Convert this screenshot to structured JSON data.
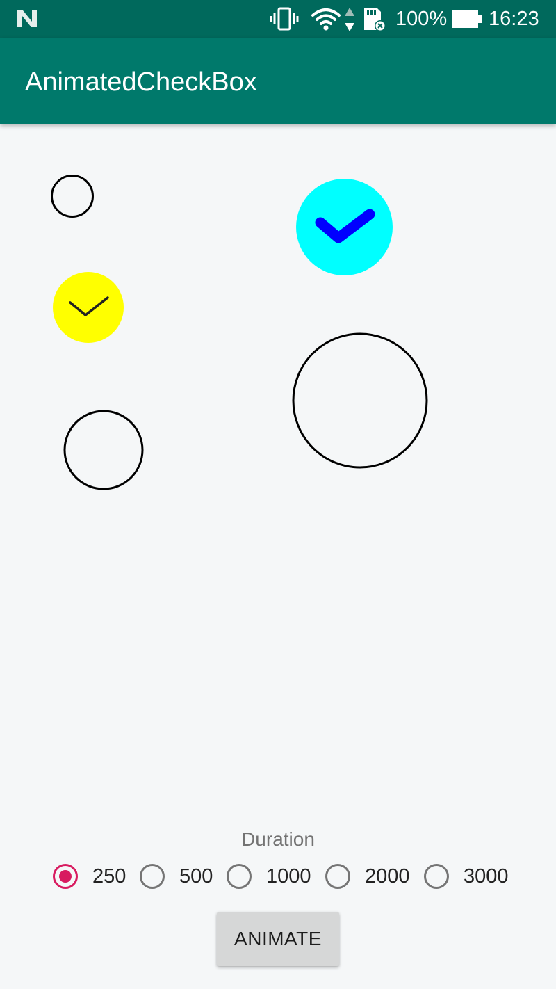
{
  "status_bar": {
    "battery_percent": "100%",
    "time": "16:23",
    "icons": [
      "n-logo-icon",
      "vibrate-icon",
      "wifi-icon",
      "data-arrows-icon",
      "sd-card-icon",
      "battery-icon"
    ]
  },
  "app_bar": {
    "title": "AnimatedCheckBox"
  },
  "checkboxes": [
    {
      "id": "small-unchecked",
      "checked": false,
      "fill_color": null,
      "stroke_color": "#000000"
    },
    {
      "id": "cyan-checked",
      "checked": true,
      "fill_color": "#00ffff",
      "check_color": "#0000ff"
    },
    {
      "id": "yellow-checked",
      "checked": true,
      "fill_color": "#ffff00",
      "check_color": "#222222"
    },
    {
      "id": "large-unchecked",
      "checked": false,
      "fill_color": null,
      "stroke_color": "#000000"
    },
    {
      "id": "medium-unchecked",
      "checked": false,
      "fill_color": null,
      "stroke_color": "#000000"
    }
  ],
  "duration": {
    "label": "Duration",
    "options": [
      "250",
      "500",
      "1000",
      "2000",
      "3000"
    ],
    "selected": "250"
  },
  "animate_button": {
    "label": "ANIMATE"
  },
  "colors": {
    "app_bar": "#00796b",
    "status_bar": "#00695c",
    "radio_accent": "#d81b60",
    "background": "#f5f7f8"
  }
}
